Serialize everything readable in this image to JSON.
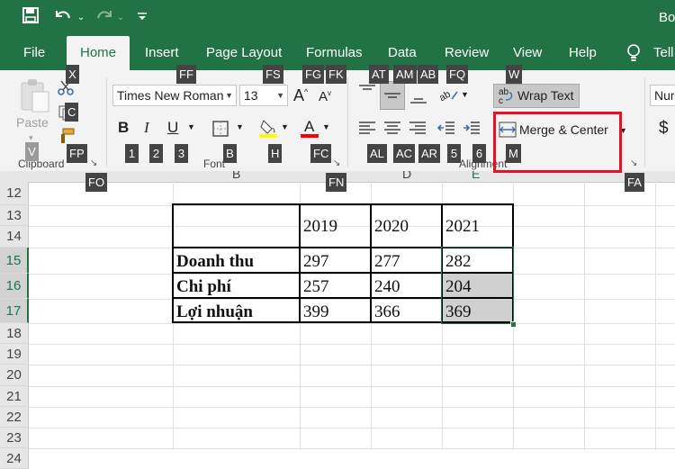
{
  "title_text": "Bo",
  "quick_access": {
    "save_icon": "save-icon",
    "undo_icon": "undo-icon",
    "redo_icon": "redo-icon",
    "customize_icon": "customize-qat-icon"
  },
  "tabs": [
    "File",
    "Home",
    "Insert",
    "Page Layout",
    "Formulas",
    "Data",
    "Review",
    "View",
    "Help",
    "Tell"
  ],
  "active_tab": "Home",
  "ribbon": {
    "clipboard": {
      "paste_label": "Paste",
      "group_label": "Clipboard"
    },
    "font": {
      "font_name": "Times New Roman",
      "font_size": "13",
      "group_label": "Font",
      "fill_color": "#ffff00",
      "font_color": "#ff0000"
    },
    "alignment": {
      "wrap_text_label": "Wrap Text",
      "merge_center_label": "Merge & Center",
      "group_label": "Alignment"
    },
    "number": {
      "format_partial": "Nur",
      "currency_symbol": "$"
    },
    "highlight_color": "#e81123"
  },
  "keytips": {
    "X": "X",
    "FF": "FF",
    "FS": "FS",
    "FG": "FG",
    "FK": "FK",
    "AT": "AT",
    "AM": "AM",
    "AB": "AB",
    "FQ": "FQ",
    "W": "W",
    "C": "C",
    "V": "V",
    "FP": "FP",
    "1": "1",
    "2": "2",
    "3": "3",
    "B": "B",
    "H": "H",
    "FC": "FC",
    "AL": "AL",
    "AC": "AC",
    "AR": "AR",
    "5": "5",
    "6": "6",
    "M": "M",
    "FO": "FO",
    "FN": "FN",
    "FA": "FA"
  },
  "column_headers_partial": [
    "B",
    "D",
    "E"
  ],
  "row_numbers": [
    "12",
    "13",
    "14",
    "15",
    "16",
    "17",
    "18",
    "19",
    "20",
    "21",
    "22",
    "23",
    "24"
  ],
  "table": {
    "years": [
      "2019",
      "2020",
      "2021"
    ],
    "rows": [
      {
        "label": "Doanh thu",
        "values": [
          "297",
          "277",
          "282"
        ]
      },
      {
        "label": "Chi phí",
        "values": [
          "257",
          "240",
          "204"
        ]
      },
      {
        "label": "Lợi nhuận",
        "values": [
          "399",
          "366",
          "369"
        ]
      }
    ]
  },
  "selection": {
    "range": "E15:E17",
    "fill": "#d0d0d0",
    "border": "#217346"
  }
}
